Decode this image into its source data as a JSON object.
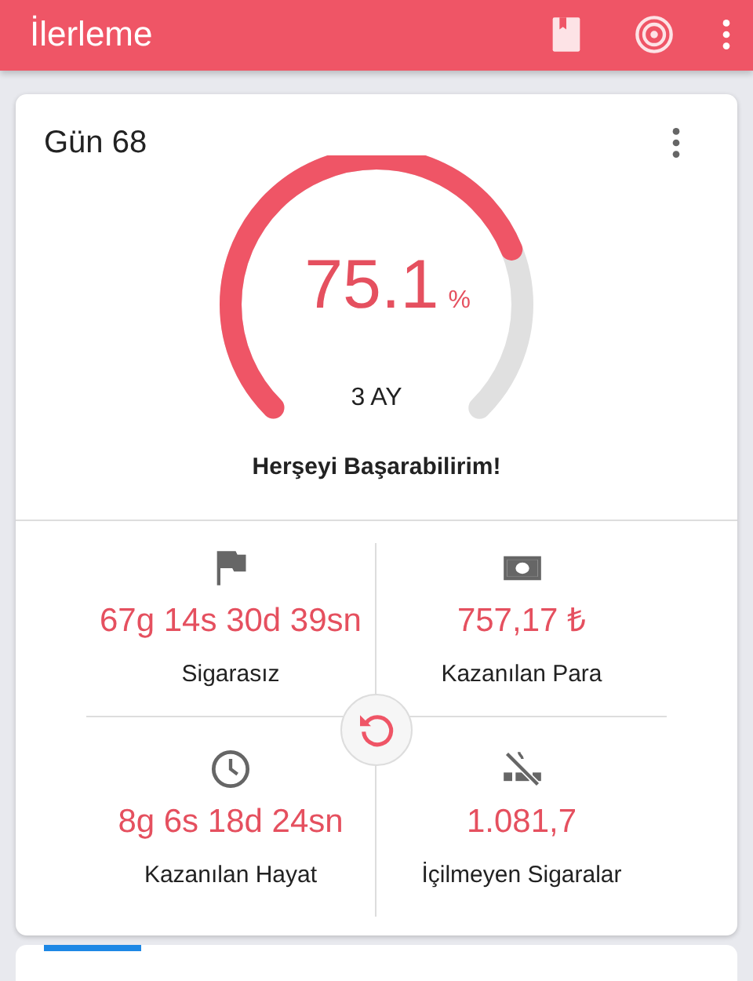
{
  "app_bar": {
    "title": "İlerleme"
  },
  "card": {
    "title": "Gün 68",
    "gauge": {
      "value": "75.1",
      "unit": "%",
      "caption": "3 AY"
    },
    "motto": "Herşeyi Başarabilirim!",
    "stats": [
      {
        "kind": "flag",
        "value": "67g 14s 30d 39sn",
        "label": "Sigarasız"
      },
      {
        "kind": "money",
        "value": "757,17 ₺",
        "label": "Kazanılan Para"
      },
      {
        "kind": "clock",
        "value": "8g 6s 18d 24sn",
        "label": "Kazanılan Hayat"
      },
      {
        "kind": "no-smoking",
        "value": "1.081,7",
        "label": "İçilmeyen Sigaralar"
      }
    ]
  }
}
